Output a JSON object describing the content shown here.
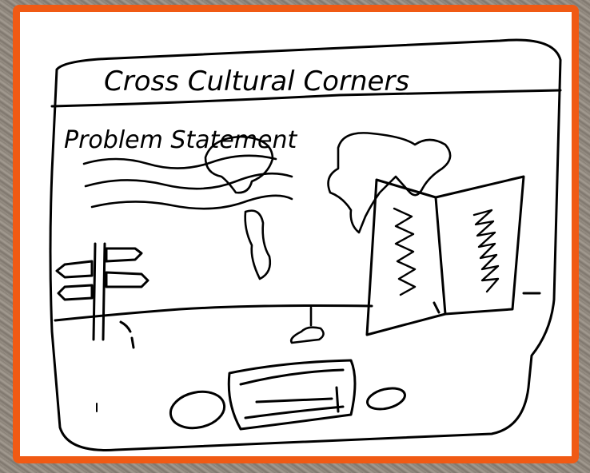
{
  "sketch": {
    "title": "Cross Cultural Corners",
    "section_heading": "Problem Statement"
  },
  "colors": {
    "frame_border": "#f05a14",
    "ink": "#000000",
    "paper": "#ffffff",
    "backdrop": "#8a8278"
  }
}
